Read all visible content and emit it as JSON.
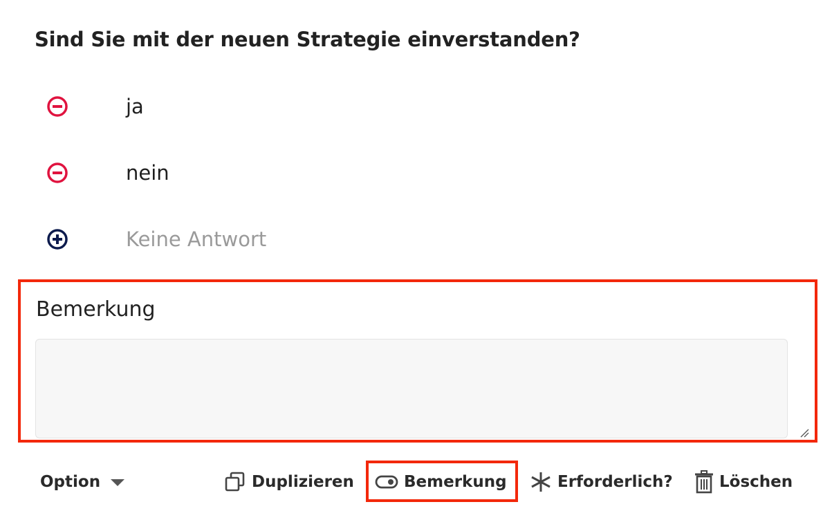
{
  "question": {
    "title": "Sind Sie mit der neuen Strategie einverstanden?"
  },
  "options": [
    {
      "label": "ja",
      "icon": "minus-circle-icon",
      "color": "#e0133f"
    },
    {
      "label": "nein",
      "icon": "minus-circle-icon",
      "color": "#e0133f"
    },
    {
      "label": "Keine Antwort",
      "icon": "plus-circle-icon",
      "color": "#0d1b4d",
      "placeholder": true
    }
  ],
  "remark": {
    "title": "Bemerkung",
    "value": "",
    "placeholder": ""
  },
  "toolbar": {
    "option_label": "Option",
    "duplicate_label": "Duplizieren",
    "remark_label": "Bemerkung",
    "required_label": "Erforderlich?",
    "delete_label": "Löschen"
  },
  "colors": {
    "highlight": "#f3280b",
    "remove": "#e0133f",
    "add": "#0d1b4d"
  }
}
